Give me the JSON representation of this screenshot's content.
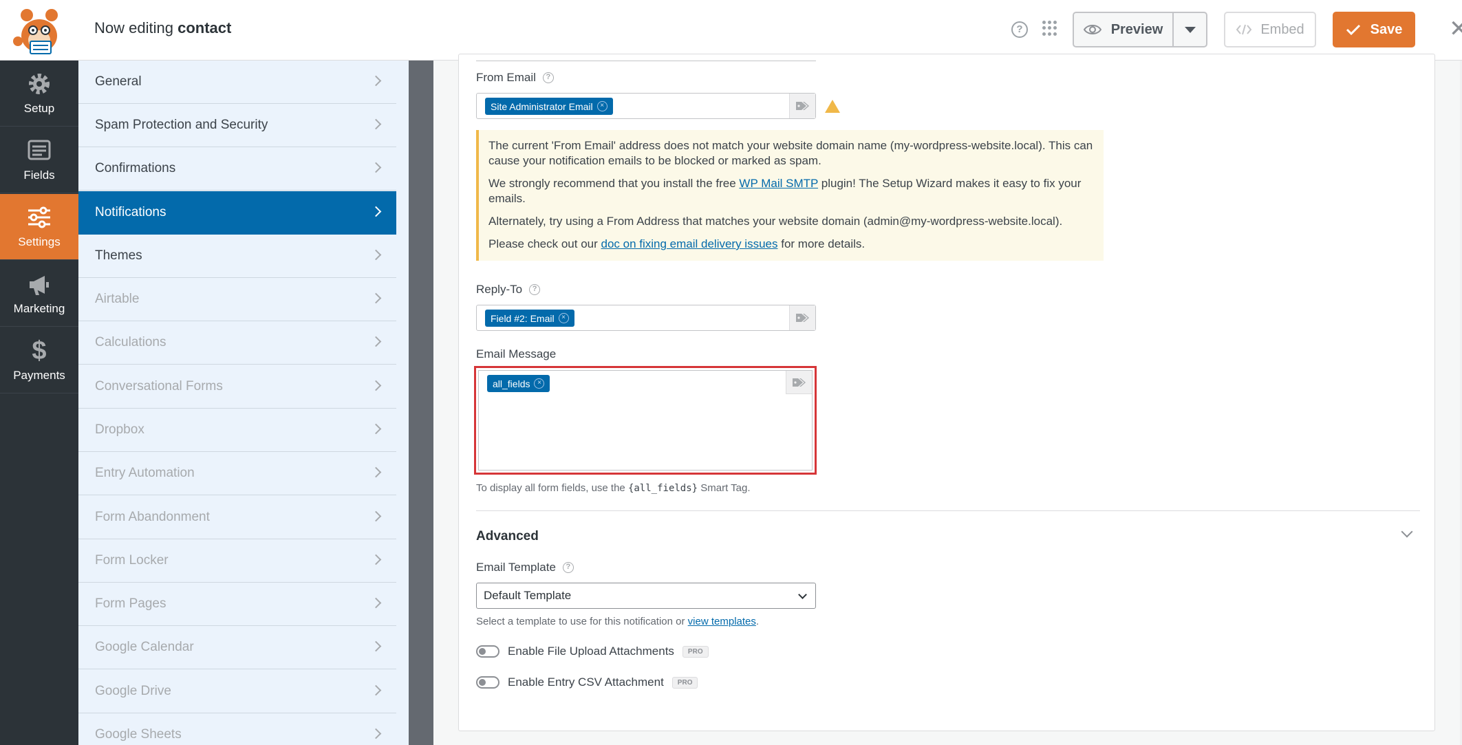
{
  "header": {
    "title_prefix": "Now editing",
    "title_form": "contact",
    "help_glyph": "?",
    "preview_label": "Preview",
    "embed_label": "Embed",
    "save_label": "Save",
    "close_glyph": "✕"
  },
  "leftnav": {
    "items": [
      {
        "label": "Setup",
        "icon": "gear-icon"
      },
      {
        "label": "Fields",
        "icon": "fields-list-icon"
      },
      {
        "label": "Settings",
        "icon": "sliders-icon"
      },
      {
        "label": "Marketing",
        "icon": "megaphone-icon"
      },
      {
        "label": "Payments",
        "icon": "dollar-icon"
      }
    ],
    "payments_glyph": "$"
  },
  "panel": {
    "items": [
      "General",
      "Spam Protection and Security",
      "Confirmations",
      "Notifications",
      "Themes",
      "Airtable",
      "Calculations",
      "Conversational Forms",
      "Dropbox",
      "Entry Automation",
      "Form Abandonment",
      "Form Locker",
      "Form Pages",
      "Google Calendar",
      "Google Drive",
      "Google Sheets"
    ],
    "active": "Notifications"
  },
  "notification": {
    "from_email_label": "From Email",
    "from_email_chip": "Site Administrator Email",
    "notice": {
      "p1": "The current 'From Email' address does not match your website domain name (my-wordpress-website.local). This can cause your notification emails to be blocked or marked as spam.",
      "p2_before": "We strongly recommend that you install the free ",
      "p2_link": "WP Mail SMTP",
      "p2_after": " plugin! The Setup Wizard makes it easy to fix your emails.",
      "p3": "Alternately, try using a From Address that matches your website domain (admin@my-wordpress-website.local).",
      "p4_before": "Please check out our ",
      "p4_link": "doc on fixing email delivery issues",
      "p4_after": " for more details."
    },
    "reply_to_label": "Reply-To",
    "reply_to_chip": "Field #2: Email",
    "email_message_label": "Email Message",
    "email_message_chip": "all_fields",
    "chip_remove_glyph": "×",
    "message_hint_before": "To display all form fields, use the ",
    "message_hint_code": "{all_fields}",
    "message_hint_after": " Smart Tag."
  },
  "advanced": {
    "title": "Advanced",
    "template_label": "Email Template",
    "template_value": "Default Template",
    "template_hint_before": "Select a template to use for this notification or ",
    "template_hint_link": "view templates",
    "template_hint_after": ".",
    "toggles": [
      {
        "label": "Enable File Upload Attachments",
        "badge": "PRO"
      },
      {
        "label": "Enable Entry CSV Attachment",
        "badge": "PRO"
      }
    ]
  },
  "colors": {
    "accent_orange": "#e27730",
    "active_blue": "#036aab",
    "highlight_red": "#d63638",
    "warning_yellow": "#f0b849"
  }
}
